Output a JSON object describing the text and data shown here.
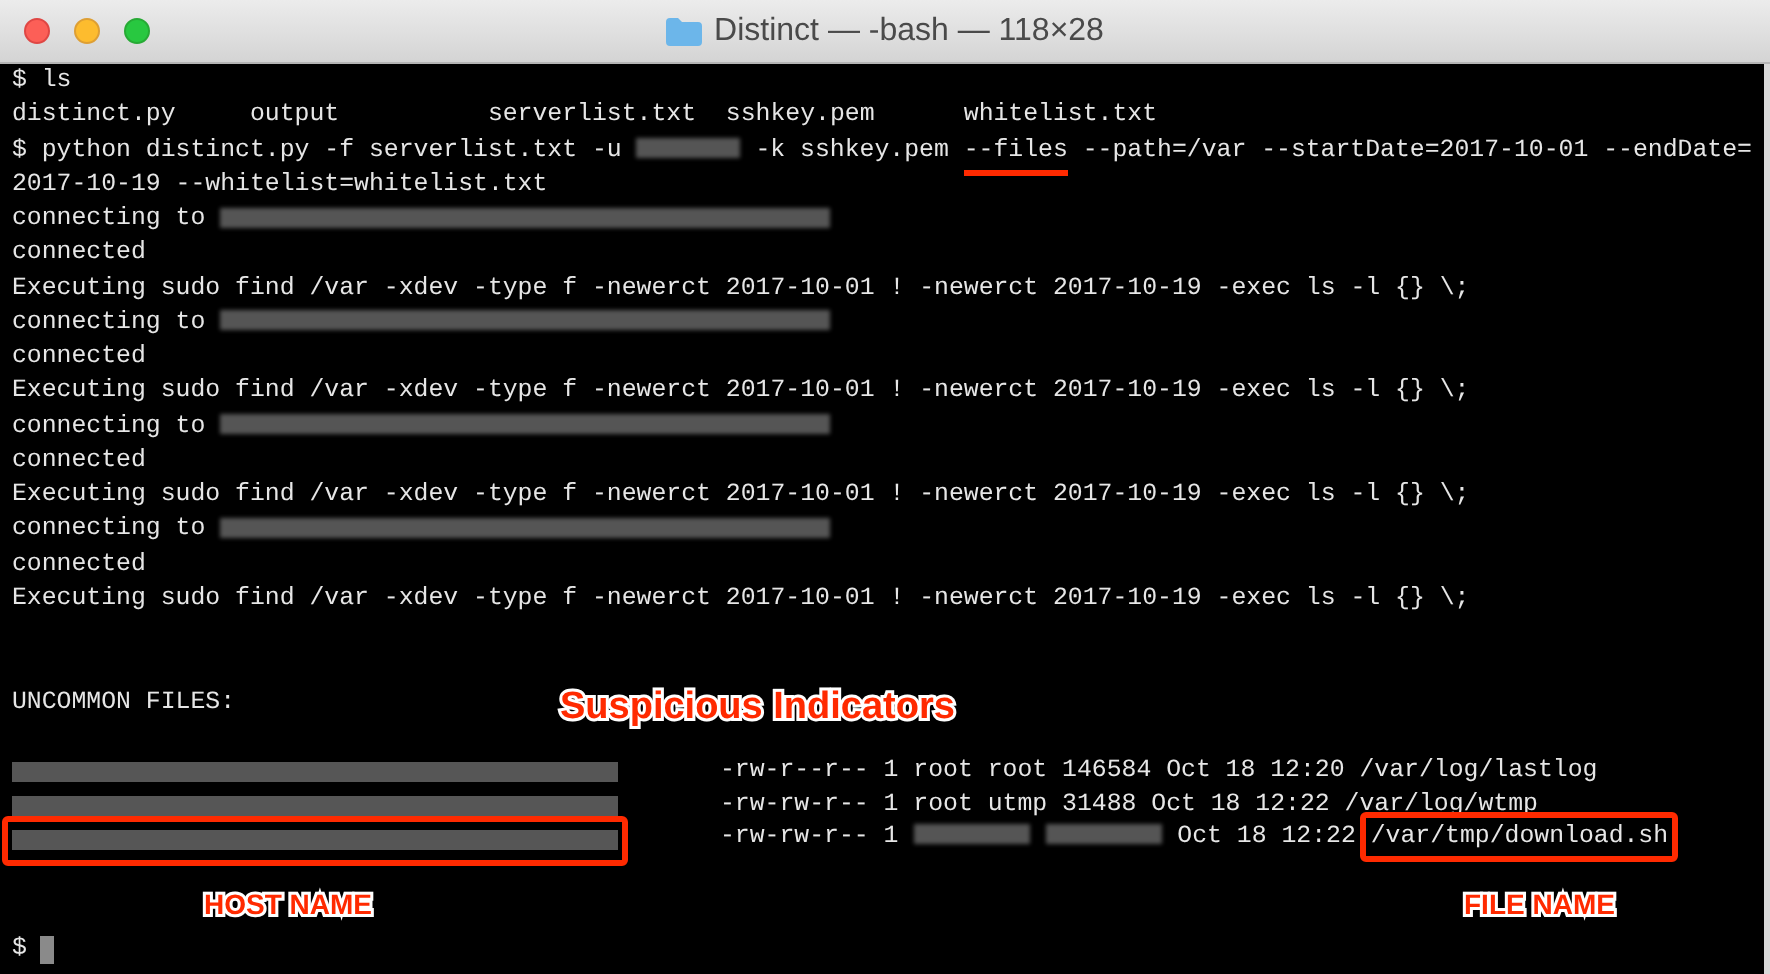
{
  "window": {
    "title": "Distinct — -bash — 118×28"
  },
  "terminal": {
    "lines": [
      {
        "segments": [
          {
            "kind": "text",
            "text": "$ ls"
          }
        ]
      },
      {
        "segments": [
          {
            "kind": "text",
            "text": "distinct.py     output          serverlist.txt  sshkey.pem      whitelist.txt"
          }
        ]
      },
      {
        "segments": [
          {
            "kind": "text",
            "text": "$ python distinct.py -f serverlist.txt -u "
          },
          {
            "kind": "redacted_short"
          },
          {
            "kind": "text",
            "text": " -k sshkey.pem "
          },
          {
            "kind": "text",
            "text": "--files",
            "underlined": true
          },
          {
            "kind": "text",
            "text": " --path=/var --startDate=2017-10-01 --endDate="
          }
        ]
      },
      {
        "segments": [
          {
            "kind": "text",
            "text": "2017-10-19 --whitelist=whitelist.txt"
          }
        ]
      },
      {
        "segments": [
          {
            "kind": "text",
            "text": "connecting to "
          },
          {
            "kind": "redacted_long"
          }
        ]
      },
      {
        "segments": [
          {
            "kind": "text",
            "text": "connected"
          }
        ]
      },
      {
        "segments": [
          {
            "kind": "text",
            "text": "Executing sudo find /var -xdev -type f -newerct 2017-10-01 ! -newerct 2017-10-19 -exec ls -l {} \\;"
          }
        ]
      },
      {
        "segments": [
          {
            "kind": "text",
            "text": "connecting to "
          },
          {
            "kind": "redacted_long"
          }
        ]
      },
      {
        "segments": [
          {
            "kind": "text",
            "text": "connected"
          }
        ]
      },
      {
        "segments": [
          {
            "kind": "text",
            "text": "Executing sudo find /var -xdev -type f -newerct 2017-10-01 ! -newerct 2017-10-19 -exec ls -l {} \\;"
          }
        ]
      },
      {
        "segments": [
          {
            "kind": "text",
            "text": "connecting to "
          },
          {
            "kind": "redacted_long"
          }
        ]
      },
      {
        "segments": [
          {
            "kind": "text",
            "text": "connected"
          }
        ]
      },
      {
        "segments": [
          {
            "kind": "text",
            "text": "Executing sudo find /var -xdev -type f -newerct 2017-10-01 ! -newerct 2017-10-19 -exec ls -l {} \\;"
          }
        ]
      },
      {
        "segments": [
          {
            "kind": "text",
            "text": "connecting to "
          },
          {
            "kind": "redacted_long"
          }
        ]
      },
      {
        "segments": [
          {
            "kind": "text",
            "text": "connected"
          }
        ]
      },
      {
        "segments": [
          {
            "kind": "text",
            "text": "Executing sudo find /var -xdev -type f -newerct 2017-10-01 ! -newerct 2017-10-19 -exec ls -l {} \\;"
          }
        ]
      }
    ],
    "heading": "UNCOMMON FILES:",
    "files": [
      {
        "host_highlighted": false,
        "segments": [
          {
            "kind": "text",
            "text": "-rw-r--r-- 1 root root 146584 Oct 18 12:20 /var/log/lastlog"
          }
        ]
      },
      {
        "host_highlighted": false,
        "segments": [
          {
            "kind": "text",
            "text": "-rw-rw-r-- 1 root utmp 31488 Oct 18 12:22 /var/log/wtmp"
          }
        ]
      },
      {
        "host_highlighted": true,
        "segments": [
          {
            "kind": "text",
            "text": "-rw-rw-r-- 1 "
          },
          {
            "kind": "redacted_owner"
          },
          {
            "kind": "redacted_owner"
          },
          {
            "kind": "text",
            "text": "Oct 18 12:22 "
          },
          {
            "kind": "text",
            "text": "/var/tmp/download.sh",
            "boxed": true
          }
        ]
      }
    ],
    "prompt": "$"
  },
  "annotations": {
    "title": "Suspicious Indicators",
    "host_label": "HOST NAME",
    "file_label": "FILE NAME"
  }
}
